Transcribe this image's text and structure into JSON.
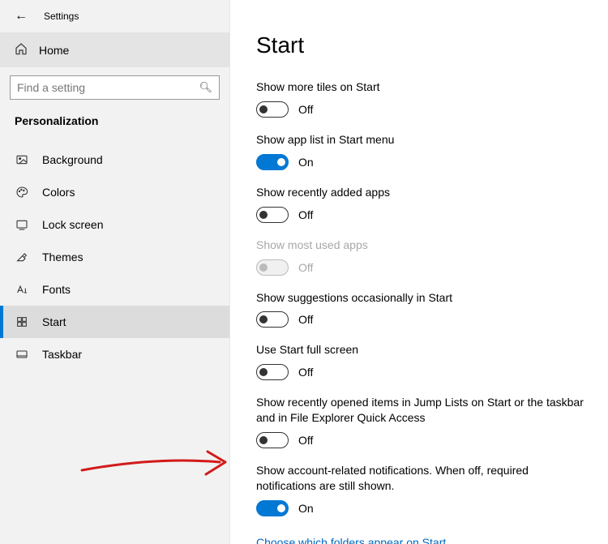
{
  "app": {
    "title": "Settings"
  },
  "sidebar": {
    "home_label": "Home",
    "search_placeholder": "Find a setting",
    "section": "Personalization",
    "items": [
      {
        "label": "Background"
      },
      {
        "label": "Colors"
      },
      {
        "label": "Lock screen"
      },
      {
        "label": "Themes"
      },
      {
        "label": "Fonts"
      },
      {
        "label": "Start"
      },
      {
        "label": "Taskbar"
      }
    ]
  },
  "page": {
    "header": "Start",
    "toggles": [
      {
        "label": "Show more tiles on Start",
        "state": "Off",
        "on": false,
        "disabled": false
      },
      {
        "label": "Show app list in Start menu",
        "state": "On",
        "on": true,
        "disabled": false
      },
      {
        "label": "Show recently added apps",
        "state": "Off",
        "on": false,
        "disabled": false
      },
      {
        "label": "Show most used apps",
        "state": "Off",
        "on": false,
        "disabled": true
      },
      {
        "label": "Show suggestions occasionally in Start",
        "state": "Off",
        "on": false,
        "disabled": false
      },
      {
        "label": "Use Start full screen",
        "state": "Off",
        "on": false,
        "disabled": false
      },
      {
        "label": "Show recently opened items in Jump Lists on Start or the taskbar and in File Explorer Quick Access",
        "state": "Off",
        "on": false,
        "disabled": false
      },
      {
        "label": "Show account-related notifications. When off, required notifications are still shown.",
        "state": "On",
        "on": true,
        "disabled": false
      }
    ],
    "link": "Choose which folders appear on Start"
  }
}
